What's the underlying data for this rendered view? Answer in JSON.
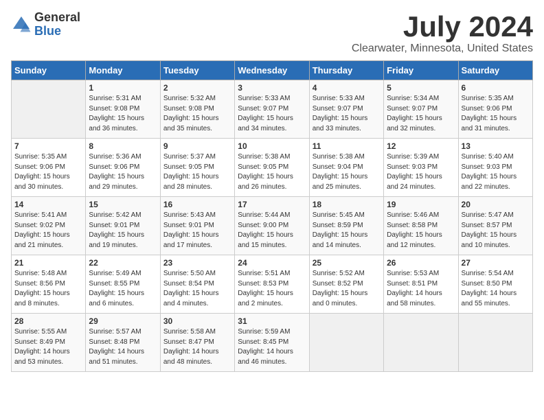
{
  "logo": {
    "general": "General",
    "blue": "Blue"
  },
  "title": "July 2024",
  "subtitle": "Clearwater, Minnesota, United States",
  "days_of_week": [
    "Sunday",
    "Monday",
    "Tuesday",
    "Wednesday",
    "Thursday",
    "Friday",
    "Saturday"
  ],
  "weeks": [
    [
      {
        "day": "",
        "info": ""
      },
      {
        "day": "1",
        "info": "Sunrise: 5:31 AM\nSunset: 9:08 PM\nDaylight: 15 hours\nand 36 minutes."
      },
      {
        "day": "2",
        "info": "Sunrise: 5:32 AM\nSunset: 9:08 PM\nDaylight: 15 hours\nand 35 minutes."
      },
      {
        "day": "3",
        "info": "Sunrise: 5:33 AM\nSunset: 9:07 PM\nDaylight: 15 hours\nand 34 minutes."
      },
      {
        "day": "4",
        "info": "Sunrise: 5:33 AM\nSunset: 9:07 PM\nDaylight: 15 hours\nand 33 minutes."
      },
      {
        "day": "5",
        "info": "Sunrise: 5:34 AM\nSunset: 9:07 PM\nDaylight: 15 hours\nand 32 minutes."
      },
      {
        "day": "6",
        "info": "Sunrise: 5:35 AM\nSunset: 9:06 PM\nDaylight: 15 hours\nand 31 minutes."
      }
    ],
    [
      {
        "day": "7",
        "info": "Sunrise: 5:35 AM\nSunset: 9:06 PM\nDaylight: 15 hours\nand 30 minutes."
      },
      {
        "day": "8",
        "info": "Sunrise: 5:36 AM\nSunset: 9:06 PM\nDaylight: 15 hours\nand 29 minutes."
      },
      {
        "day": "9",
        "info": "Sunrise: 5:37 AM\nSunset: 9:05 PM\nDaylight: 15 hours\nand 28 minutes."
      },
      {
        "day": "10",
        "info": "Sunrise: 5:38 AM\nSunset: 9:05 PM\nDaylight: 15 hours\nand 26 minutes."
      },
      {
        "day": "11",
        "info": "Sunrise: 5:38 AM\nSunset: 9:04 PM\nDaylight: 15 hours\nand 25 minutes."
      },
      {
        "day": "12",
        "info": "Sunrise: 5:39 AM\nSunset: 9:03 PM\nDaylight: 15 hours\nand 24 minutes."
      },
      {
        "day": "13",
        "info": "Sunrise: 5:40 AM\nSunset: 9:03 PM\nDaylight: 15 hours\nand 22 minutes."
      }
    ],
    [
      {
        "day": "14",
        "info": "Sunrise: 5:41 AM\nSunset: 9:02 PM\nDaylight: 15 hours\nand 21 minutes."
      },
      {
        "day": "15",
        "info": "Sunrise: 5:42 AM\nSunset: 9:01 PM\nDaylight: 15 hours\nand 19 minutes."
      },
      {
        "day": "16",
        "info": "Sunrise: 5:43 AM\nSunset: 9:01 PM\nDaylight: 15 hours\nand 17 minutes."
      },
      {
        "day": "17",
        "info": "Sunrise: 5:44 AM\nSunset: 9:00 PM\nDaylight: 15 hours\nand 15 minutes."
      },
      {
        "day": "18",
        "info": "Sunrise: 5:45 AM\nSunset: 8:59 PM\nDaylight: 15 hours\nand 14 minutes."
      },
      {
        "day": "19",
        "info": "Sunrise: 5:46 AM\nSunset: 8:58 PM\nDaylight: 15 hours\nand 12 minutes."
      },
      {
        "day": "20",
        "info": "Sunrise: 5:47 AM\nSunset: 8:57 PM\nDaylight: 15 hours\nand 10 minutes."
      }
    ],
    [
      {
        "day": "21",
        "info": "Sunrise: 5:48 AM\nSunset: 8:56 PM\nDaylight: 15 hours\nand 8 minutes."
      },
      {
        "day": "22",
        "info": "Sunrise: 5:49 AM\nSunset: 8:55 PM\nDaylight: 15 hours\nand 6 minutes."
      },
      {
        "day": "23",
        "info": "Sunrise: 5:50 AM\nSunset: 8:54 PM\nDaylight: 15 hours\nand 4 minutes."
      },
      {
        "day": "24",
        "info": "Sunrise: 5:51 AM\nSunset: 8:53 PM\nDaylight: 15 hours\nand 2 minutes."
      },
      {
        "day": "25",
        "info": "Sunrise: 5:52 AM\nSunset: 8:52 PM\nDaylight: 15 hours\nand 0 minutes."
      },
      {
        "day": "26",
        "info": "Sunrise: 5:53 AM\nSunset: 8:51 PM\nDaylight: 14 hours\nand 58 minutes."
      },
      {
        "day": "27",
        "info": "Sunrise: 5:54 AM\nSunset: 8:50 PM\nDaylight: 14 hours\nand 55 minutes."
      }
    ],
    [
      {
        "day": "28",
        "info": "Sunrise: 5:55 AM\nSunset: 8:49 PM\nDaylight: 14 hours\nand 53 minutes."
      },
      {
        "day": "29",
        "info": "Sunrise: 5:57 AM\nSunset: 8:48 PM\nDaylight: 14 hours\nand 51 minutes."
      },
      {
        "day": "30",
        "info": "Sunrise: 5:58 AM\nSunset: 8:47 PM\nDaylight: 14 hours\nand 48 minutes."
      },
      {
        "day": "31",
        "info": "Sunrise: 5:59 AM\nSunset: 8:45 PM\nDaylight: 14 hours\nand 46 minutes."
      },
      {
        "day": "",
        "info": ""
      },
      {
        "day": "",
        "info": ""
      },
      {
        "day": "",
        "info": ""
      }
    ]
  ]
}
